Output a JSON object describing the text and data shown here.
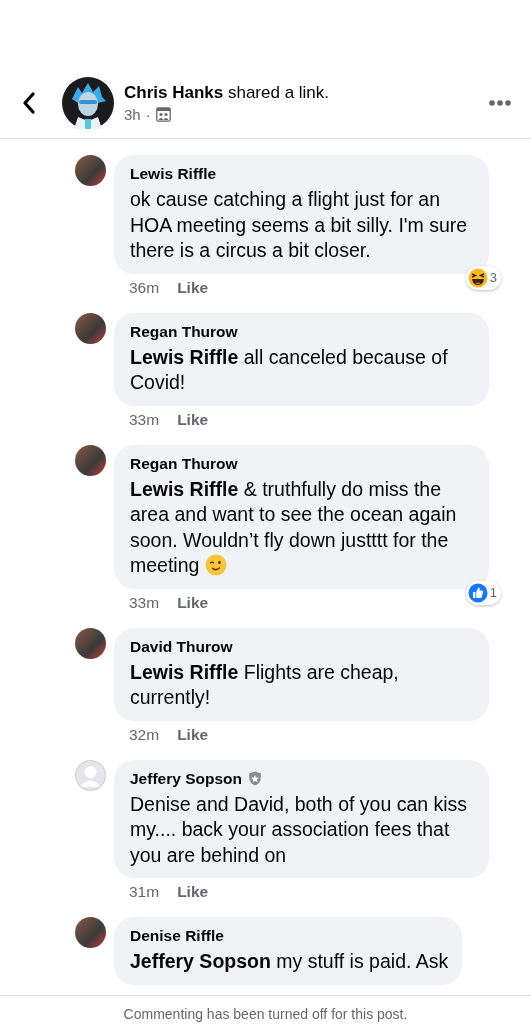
{
  "header": {
    "author": "Chris Hanks",
    "action": "shared a link.",
    "time": "3h",
    "separator": "·"
  },
  "comments": [
    {
      "author": "Lewis Riffle",
      "verified": false,
      "avatar": {
        "kind": "photo"
      },
      "text": "ok cause catching a flight just for an HOA meeting seems a bit silly. I'm sure there is a circus a bit closer.",
      "wink": false,
      "time": "36m",
      "like": "Like",
      "reaction": {
        "kind": "haha",
        "count": "3"
      }
    },
    {
      "author": "Regan Thurow",
      "verified": false,
      "avatar": {
        "kind": "photo"
      },
      "text": "**Lewis Riffle** all canceled because of Covid!",
      "wink": false,
      "time": "33m",
      "like": "Like"
    },
    {
      "author": "Regan Thurow",
      "verified": false,
      "avatar": {
        "kind": "photo"
      },
      "text": "**Lewis Riffle** & truthfully do miss the area and want to see the ocean again soon. Wouldn’t fly down justttt for the meeting",
      "wink": true,
      "time": "33m",
      "like": "Like",
      "reaction": {
        "kind": "like",
        "count": "1"
      }
    },
    {
      "author": "David Thurow",
      "verified": false,
      "avatar": {
        "kind": "photo"
      },
      "text": "**Lewis Riffle** Flights are cheap, currently!",
      "wink": false,
      "time": "32m",
      "like": "Like"
    },
    {
      "author": "Jeffery Sopson",
      "verified": true,
      "avatar": {
        "kind": "default"
      },
      "text": "Denise and David, both of you can kiss my.... back your association fees that you are behind on",
      "wink": false,
      "time": "31m",
      "like": "Like"
    },
    {
      "author": "Denise Riffle",
      "verified": false,
      "avatar": {
        "kind": "photo"
      },
      "text": "**Jeffery Sopson** my stuff is paid. Ask",
      "wink": false
    }
  ],
  "footer": {
    "notice": "Commenting has been turned off for this post."
  }
}
